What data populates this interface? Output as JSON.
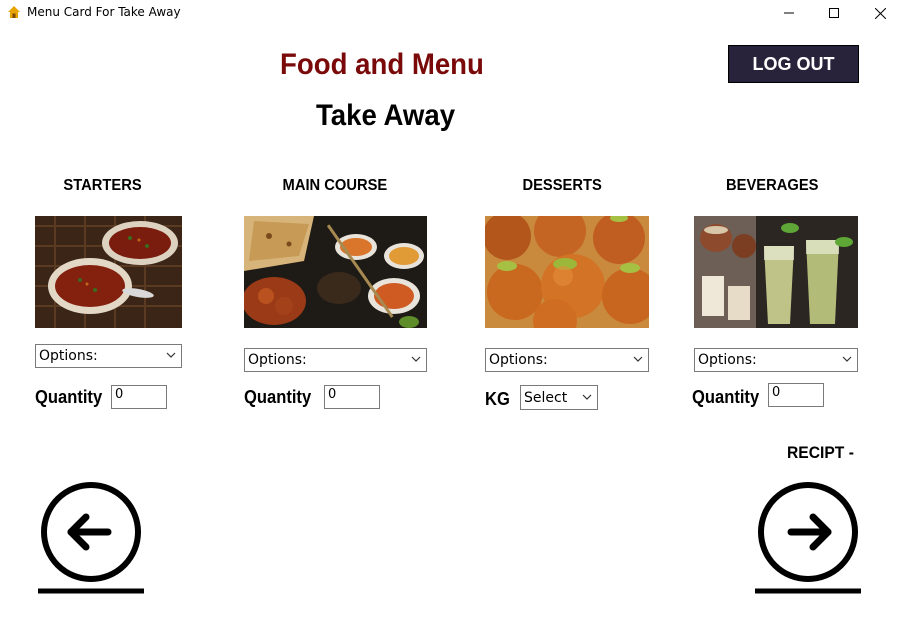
{
  "window": {
    "title": "Menu Card For Take Away",
    "controls": [
      "minimize-icon",
      "maximize-icon",
      "close-icon"
    ]
  },
  "header": {
    "title": "Food and Menu",
    "subtitle": "Take Away",
    "title_color": "#7a0a0a",
    "logout_label": "LOG OUT"
  },
  "categories": [
    {
      "label": "STARTERS",
      "image": "soup-bowls-photo",
      "select_value": "Options:",
      "qty_label": "Quantity",
      "qty_value": "0"
    },
    {
      "label": "MAIN COURSE",
      "image": "indian-main-course-photo",
      "select_value": "Options:",
      "qty_label": "Quantity",
      "qty_value": "0"
    },
    {
      "label": "DESSERTS",
      "image": "gulab-jamun-photo",
      "select_value": "Options:",
      "qty_label": "KG",
      "qty_value": "Select"
    },
    {
      "label": "BEVERAGES",
      "image": "drinks-photo",
      "select_value": "Options:",
      "qty_label": "Quantity",
      "qty_value": "0"
    }
  ],
  "receipt_label": "RECIPT -",
  "navigation": {
    "prev": "arrow-left-icon",
    "next": "arrow-right-icon"
  },
  "colors": {
    "logout_bg": "#28233a",
    "accent_red": "#7a0a0a"
  }
}
